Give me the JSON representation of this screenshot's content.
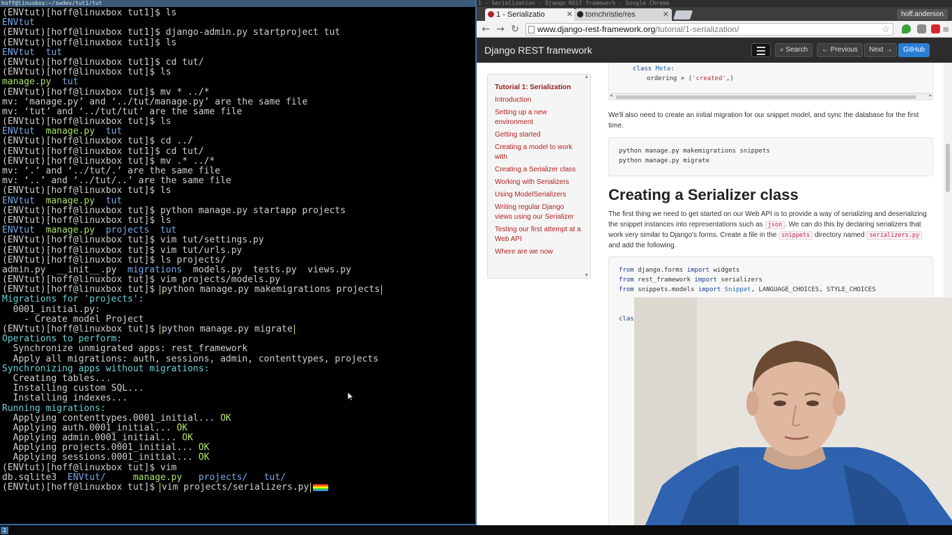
{
  "terminal": {
    "title": "hoff@linuxbox:~/swdev/tut1/tut",
    "lines": [
      [
        [
          "(ENVtut)[hoff@linuxbox tut1]$ ls",
          "norm"
        ]
      ],
      [
        [
          "ENVtut",
          "dir"
        ]
      ],
      [
        [
          "(ENVtut)[hoff@linuxbox tut1]$ django-admin.py startproject tut",
          "norm"
        ]
      ],
      [
        [
          "(ENVtut)[hoff@linuxbox tut1]$ ls",
          "norm"
        ]
      ],
      [
        [
          "ENVtut  tut",
          "dir"
        ]
      ],
      [
        [
          "(ENVtut)[hoff@linuxbox tut1]$ cd tut/",
          "norm"
        ]
      ],
      [
        [
          "(ENVtut)[hoff@linuxbox tut]$ ls",
          "norm"
        ]
      ],
      [
        [
          "manage.py",
          "py"
        ],
        [
          "  ",
          "norm"
        ],
        [
          "tut",
          "dir"
        ]
      ],
      [
        [
          "(ENVtut)[hoff@linuxbox tut]$ mv * ../*",
          "norm"
        ]
      ],
      [
        [
          "mv: ‘manage.py’ and ‘../tut/manage.py’ are the same file",
          "norm"
        ]
      ],
      [
        [
          "mv: ‘tut’ and ‘../tut/tut’ are the same file",
          "norm"
        ]
      ],
      [
        [
          "(ENVtut)[hoff@linuxbox tut]$ ls",
          "norm"
        ]
      ],
      [
        [
          "ENVtut",
          "dir"
        ],
        [
          "  ",
          "norm"
        ],
        [
          "manage.py",
          "py"
        ],
        [
          "  ",
          "norm"
        ],
        [
          "tut",
          "dir"
        ]
      ],
      [
        [
          "(ENVtut)[hoff@linuxbox tut]$ cd ../",
          "norm"
        ]
      ],
      [
        [
          "(ENVtut)[hoff@linuxbox tut1]$ cd tut/",
          "norm"
        ]
      ],
      [
        [
          "(ENVtut)[hoff@linuxbox tut]$ mv .* ../*",
          "norm"
        ]
      ],
      [
        [
          "mv: ‘.’ and ‘../tut/.’ are the same file",
          "norm"
        ]
      ],
      [
        [
          "mv: ‘..’ and ‘../tut/..’ are the same file",
          "norm"
        ]
      ],
      [
        [
          "(ENVtut)[hoff@linuxbox tut]$ ls",
          "norm"
        ]
      ],
      [
        [
          "ENVtut",
          "dir"
        ],
        [
          "  ",
          "norm"
        ],
        [
          "manage.py",
          "py"
        ],
        [
          "  ",
          "norm"
        ],
        [
          "tut",
          "dir"
        ]
      ],
      [
        [
          "(ENVtut)[hoff@linuxbox tut]$ python manage.py startapp projects",
          "norm"
        ]
      ],
      [
        [
          "(ENVtut)[hoff@linuxbox tut]$ ls",
          "norm"
        ]
      ],
      [
        [
          "ENVtut",
          "dir"
        ],
        [
          "  ",
          "norm"
        ],
        [
          "manage.py",
          "py"
        ],
        [
          "  ",
          "norm"
        ],
        [
          "projects",
          "dir"
        ],
        [
          "  ",
          "norm"
        ],
        [
          "tut",
          "dir"
        ]
      ],
      [
        [
          "(ENVtut)[hoff@linuxbox tut]$ vim tut/settings.py",
          "norm"
        ]
      ],
      [
        [
          "(ENVtut)[hoff@linuxbox tut]$ vim tut/urls.py",
          "norm"
        ]
      ],
      [
        [
          "(ENVtut)[hoff@linuxbox tut]$ ls projects/",
          "norm"
        ]
      ],
      [
        [
          "admin.py  __init__.py  ",
          "norm"
        ],
        [
          "migrations",
          "dir"
        ],
        [
          "  models.py  tests.py  views.py",
          "norm"
        ]
      ],
      [
        [
          "(ENVtut)[hoff@linuxbox tut]$ vim projects/models.py",
          "norm"
        ]
      ],
      [
        [
          "(ENVtut)[hoff@linuxbox tut]$ ",
          "norm"
        ],
        [
          "python manage.py makemigrations projects",
          "hl"
        ]
      ],
      [
        [
          "Migrations for 'projects':",
          "cyan"
        ]
      ],
      [
        [
          "  0001_initial.py:",
          "norm"
        ]
      ],
      [
        [
          "    - Create model Project",
          "norm"
        ]
      ],
      [
        [
          "(ENVtut)[hoff@linuxbox tut]$ ",
          "norm"
        ],
        [
          "python manage.py migrate",
          "hl"
        ]
      ],
      [
        [
          "Operations to perform:",
          "cyan"
        ]
      ],
      [
        [
          "  Synchronize unmigrated apps: ",
          "norm"
        ],
        [
          "rest_framework",
          "norm"
        ]
      ],
      [
        [
          "  Apply all migrations: ",
          "norm"
        ],
        [
          "auth, sessions, admin, contenttypes, projects",
          "norm"
        ]
      ],
      [
        [
          "Synchronizing apps without migrations:",
          "cyan"
        ]
      ],
      [
        [
          "  Creating tables...",
          "norm"
        ]
      ],
      [
        [
          "  Installing custom SQL...",
          "norm"
        ]
      ],
      [
        [
          "  Installing indexes...",
          "norm"
        ]
      ],
      [
        [
          "Running migrations:",
          "cyan"
        ]
      ],
      [
        [
          "  Applying contenttypes.0001_initial... ",
          "norm"
        ],
        [
          "OK",
          "ok"
        ]
      ],
      [
        [
          "  Applying auth.0001_initial... ",
          "norm"
        ],
        [
          "OK",
          "ok"
        ]
      ],
      [
        [
          "  Applying admin.0001_initial... ",
          "norm"
        ],
        [
          "OK",
          "ok"
        ]
      ],
      [
        [
          "  Applying projects.0001_initial... ",
          "norm"
        ],
        [
          "OK",
          "ok"
        ]
      ],
      [
        [
          "  Applying sessions.0001_initial... ",
          "norm"
        ],
        [
          "OK",
          "ok"
        ]
      ],
      [
        [
          "(ENVtut)[hoff@linuxbox tut]$ vim",
          "norm"
        ]
      ],
      [
        [
          "db.sqlite3  ",
          "norm"
        ],
        [
          "ENVtut/",
          "dir"
        ],
        [
          "     ",
          "norm"
        ],
        [
          "manage.py",
          "py"
        ],
        [
          "   ",
          "norm"
        ],
        [
          "projects/",
          "dir"
        ],
        [
          "   ",
          "norm"
        ],
        [
          "tut/",
          "dir"
        ]
      ],
      [
        [
          "(ENVtut)[hoff@linuxbox tut]$ ",
          "norm"
        ],
        [
          "vim projects/serializers.py",
          "hl"
        ]
      ]
    ],
    "workspace_number": "2"
  },
  "browser": {
    "window_title": "1 - Serialization - Django REST framework - Google Chrome",
    "tabs": [
      {
        "label": "1 - Serializatio",
        "active": true
      },
      {
        "label": "tomchristie/res",
        "active": false
      }
    ],
    "profile": "hoff.anderson",
    "url_host": "www.django-rest-framework.org",
    "url_path": "/tutorial/1-serialization/"
  },
  "site": {
    "brand": "Django REST framework",
    "nav": {
      "search": "Search",
      "previous": "Previous",
      "next": "Next",
      "github": "GitHub"
    },
    "toc": [
      "Tutorial 1: Serialization",
      "Introduction",
      "Setting up a new environment",
      "Getting started",
      "Creating a model to work with",
      "Creating a Serializer class",
      "Working with Serializers",
      "Using ModelSerializers",
      "Writing regular Django views using our Serializer",
      "Testing our first attempt at a Web API",
      "Where are we now"
    ],
    "code_top": {
      "kw": "class",
      "name": "Meta",
      "line2_a": "ordering = (",
      "line2_str": "'created'",
      "line2_b": ",)"
    },
    "para1": "We'll also need to create an initial migration for our snippet model, and sync the database for the first time.",
    "code_mig": [
      "python manage.py makemigrations snippets",
      "python manage.py migrate"
    ],
    "heading": "Creating a Serializer class",
    "para2": {
      "a": "The first thing we need to get started on our Web API is to provide a way of serializing and deserializing the snippet instances into representations such as",
      "code1": "json",
      "b": ". We can do this by declaring serializers that work very similar to Django's forms. Create a file in the",
      "code2": "snippets",
      "c": "directory named",
      "code3": "serializers.py",
      "d": "and add the following."
    },
    "code_imports": {
      "l1": {
        "from": "from",
        "mod": "django.forms",
        "imp": "import",
        "name": "widgets"
      },
      "l2": {
        "from": "from",
        "mod": "rest_framework",
        "imp": "import",
        "name": "serializers"
      },
      "l3": {
        "from": "from",
        "mod": "snippets.models",
        "imp": "import",
        "cls": "Snippet",
        "rest": ", LANGUAGE_CHOICES, STYLE_CHOICES"
      },
      "l5": "class"
    }
  }
}
